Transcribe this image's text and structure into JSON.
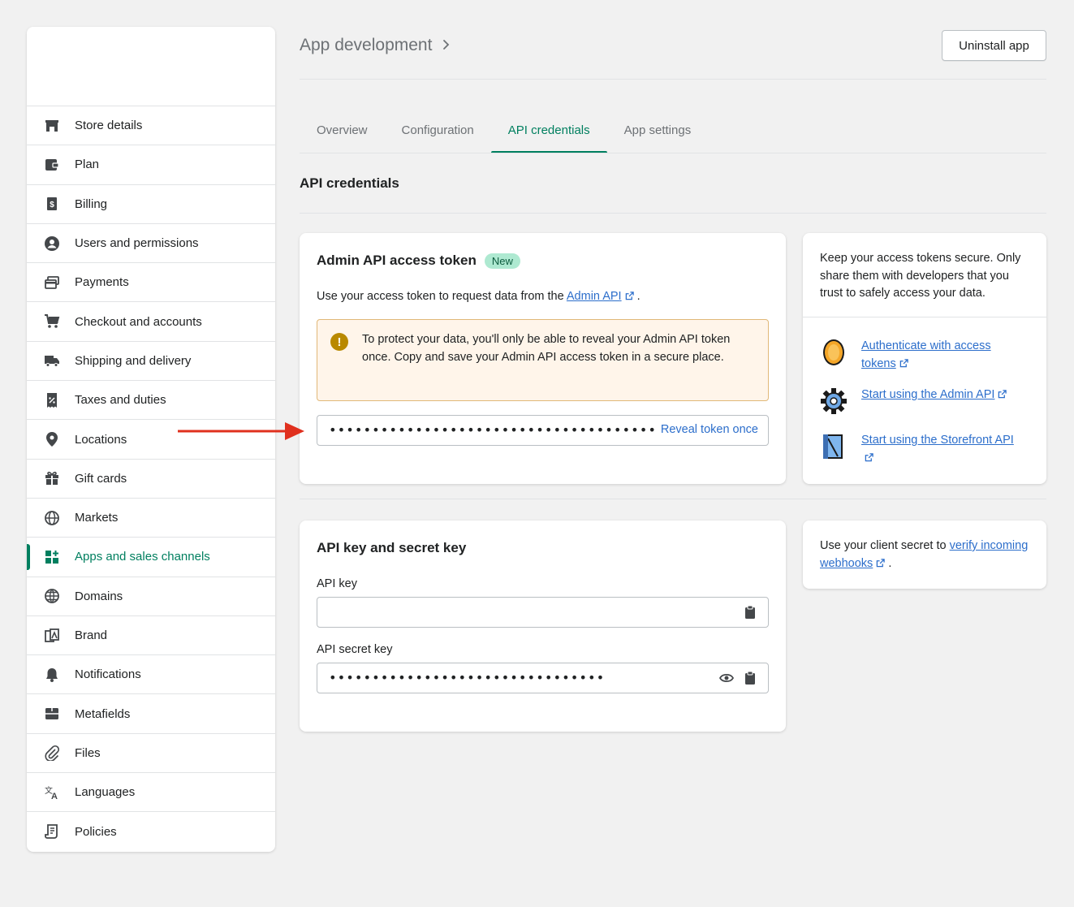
{
  "sidebar": {
    "items": [
      {
        "label": "Store details",
        "icon": "store-icon",
        "active": false
      },
      {
        "label": "Plan",
        "icon": "plan-icon",
        "active": false
      },
      {
        "label": "Billing",
        "icon": "billing-icon",
        "active": false
      },
      {
        "label": "Users and permissions",
        "icon": "user-icon",
        "active": false
      },
      {
        "label": "Payments",
        "icon": "payments-icon",
        "active": false
      },
      {
        "label": "Checkout and accounts",
        "icon": "cart-icon",
        "active": false
      },
      {
        "label": "Shipping and delivery",
        "icon": "truck-icon",
        "active": false
      },
      {
        "label": "Taxes and duties",
        "icon": "tax-icon",
        "active": false
      },
      {
        "label": "Locations",
        "icon": "location-pin-icon",
        "active": false
      },
      {
        "label": "Gift cards",
        "icon": "gift-icon",
        "active": false
      },
      {
        "label": "Markets",
        "icon": "globe-icon",
        "active": false
      },
      {
        "label": "Apps and sales channels",
        "icon": "apps-icon",
        "active": true
      },
      {
        "label": "Domains",
        "icon": "domains-icon",
        "active": false
      },
      {
        "label": "Brand",
        "icon": "brand-icon",
        "active": false
      },
      {
        "label": "Notifications",
        "icon": "bell-icon",
        "active": false
      },
      {
        "label": "Metafields",
        "icon": "metafields-icon",
        "active": false
      },
      {
        "label": "Files",
        "icon": "paperclip-icon",
        "active": false
      },
      {
        "label": "Languages",
        "icon": "translate-icon",
        "active": false
      },
      {
        "label": "Policies",
        "icon": "policies-icon",
        "active": false
      }
    ]
  },
  "header": {
    "title": "App development",
    "uninstall_label": "Uninstall app"
  },
  "tabs": [
    {
      "label": "Overview",
      "active": false
    },
    {
      "label": "Configuration",
      "active": false
    },
    {
      "label": "API credentials",
      "active": true
    },
    {
      "label": "App settings",
      "active": false
    }
  ],
  "section_title": "API credentials",
  "admin_token": {
    "title": "Admin API access token",
    "badge": "New",
    "desc_prefix": "Use your access token to request data from the ",
    "desc_link": "Admin API",
    "desc_suffix": " .",
    "warning": "To protect your data, you'll only be able to reveal your Admin API token once. Copy and save your Admin API access token in a secure place.",
    "token_mask": "••••••••••••••••••••••••••••••••••••••",
    "reveal_label": "Reveal token once"
  },
  "security_card": {
    "text": "Keep your access tokens secure. Only share them with developers that you trust to safely access your data.",
    "resources": [
      {
        "label": "Authenticate with access tokens",
        "icon": "coin-icon"
      },
      {
        "label": "Start using the Admin API",
        "icon": "gear-icon"
      },
      {
        "label": "Start using the Storefront API",
        "icon": "storefront-icon"
      }
    ]
  },
  "api_keys": {
    "title": "API key and secret key",
    "key_label": "API key",
    "key_value": "",
    "secret_label": "API secret key",
    "secret_mask": "••••••••••••••••••••••••••••••••"
  },
  "webhook_card": {
    "prefix": "Use your client secret to ",
    "link": "verify incoming webhooks",
    "suffix": " ."
  },
  "colors": {
    "accent": "#007f5f",
    "link": "#2c6ecb",
    "arrow": "#e0301e",
    "warning_bg": "#fff5ea"
  }
}
